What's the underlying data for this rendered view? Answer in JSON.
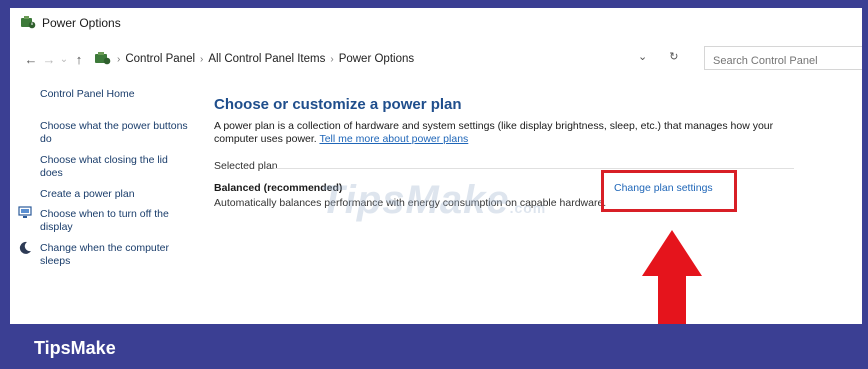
{
  "window": {
    "title": "Power Options"
  },
  "nav": {
    "back": "←",
    "forward": "→",
    "recent": "⌄",
    "up": "↑",
    "breadcrumbs": [
      "Control Panel",
      "All Control Panel Items",
      "Power Options"
    ],
    "dropdown": "⌄",
    "refresh": "↻",
    "search_placeholder": "Search Control Panel"
  },
  "sidebar": {
    "home": "Control Panel Home",
    "items": [
      "Choose what the power buttons do",
      "Choose what closing the lid does",
      "Create a power plan",
      "Choose when to turn off the display",
      "Change when the computer sleeps"
    ]
  },
  "main": {
    "heading": "Choose or customize a power plan",
    "description": "A power plan is a collection of hardware and system settings (like display brightness, sleep, etc.) that manages how your computer uses power.",
    "learn_more": "Tell me more about power plans",
    "selected_label": "Selected plan",
    "plan_name": "Balanced (recommended)",
    "plan_description": "Automatically balances performance with energy consumption on capable hardware.",
    "change_link": "Change plan settings"
  },
  "watermark": {
    "text": "TipsMake",
    "suffix": ".com"
  },
  "banner": {
    "text": "TipsMake"
  },
  "colors": {
    "highlight": "#d81f26",
    "banner": "#3b3f93",
    "link": "#1f66b8"
  }
}
